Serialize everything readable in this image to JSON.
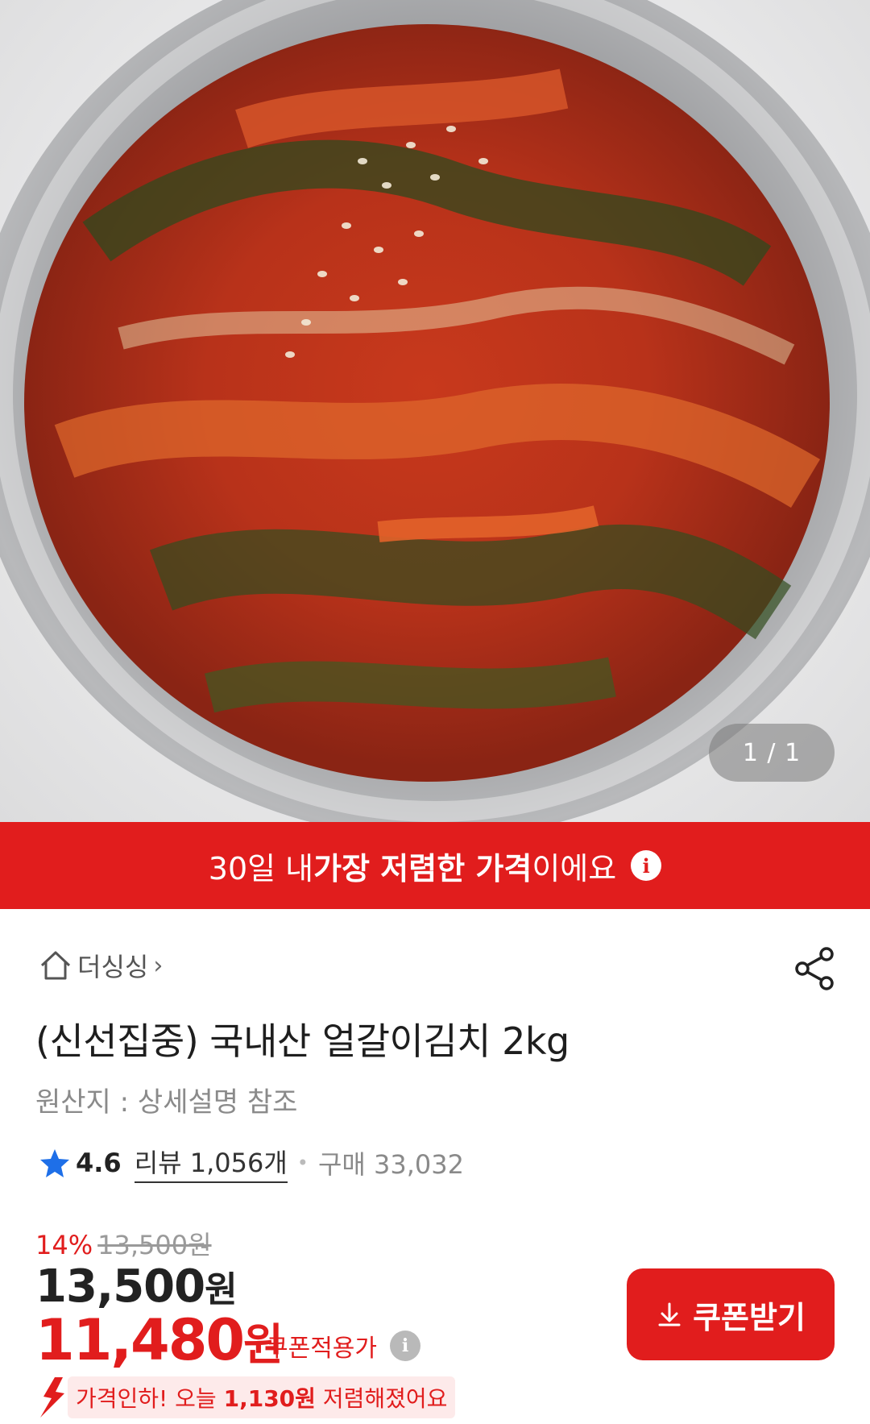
{
  "gallery": {
    "counter": "1 / 1",
    "image_alt": "kimchi-photo"
  },
  "promo": {
    "prefix": "30일 내 ",
    "highlight": "가장 저렴한 가격",
    "suffix": "이에요"
  },
  "store": {
    "name": "더싱싱"
  },
  "product": {
    "title": "(신선집중) 국내산 얼갈이김치 2kg",
    "origin": "원산지 : 상세설명 참조",
    "rating": "4.6",
    "reviews": "리뷰 1,056개",
    "purchases": "구매 33,032"
  },
  "pricing": {
    "discount_pct": "14%",
    "original_price": "13,500원",
    "price_num": "13,500",
    "price_unit": "원",
    "coupon_price_num": "11,480",
    "coupon_price_unit": "원",
    "coupon_label": "쿠폰적용가",
    "coupon_button": "쿠폰받기",
    "drop_prefix": "가격인하! 오늘 ",
    "drop_amount": "1,130원",
    "drop_suffix": " 저렴해졌어요"
  },
  "colors": {
    "accent": "#e11d1d",
    "star": "#1e6fe8"
  }
}
